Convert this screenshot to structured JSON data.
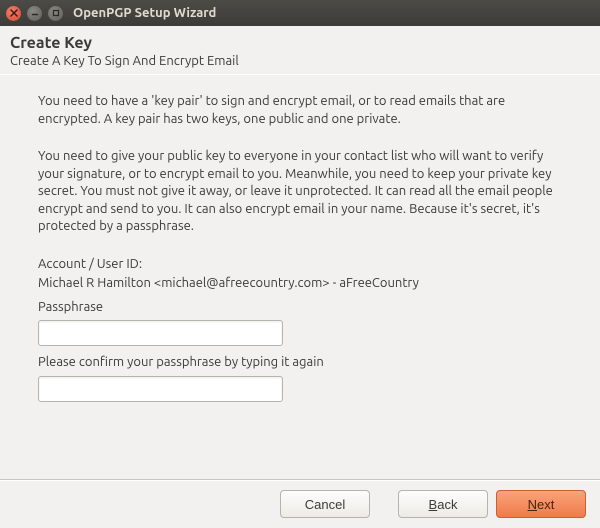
{
  "window": {
    "title": "OpenPGP Setup Wizard"
  },
  "header": {
    "title": "Create Key",
    "subtitle": "Create A Key To Sign And Encrypt Email"
  },
  "body": {
    "para1": "You need to have a 'key pair' to sign and encrypt email, or to read emails that are encrypted. A key pair has two keys, one public and one private.",
    "para2": "You need to give your public key to everyone in your contact list who will want to verify your signature, or to encrypt email to you. Meanwhile, you need to keep your private key secret. You must not give it away, or leave it unprotected. It can read all the email people encrypt and send to you. It can also encrypt email in your name. Because it's secret, it's protected by a passphrase.",
    "account_label": "Account / User ID:",
    "account_value": "Michael R Hamilton <michael@afreecountry.com> - aFreeCountry",
    "passphrase_label": "Passphrase",
    "confirm_label": "Please confirm your passphrase by typing it again"
  },
  "buttons": {
    "cancel": "Cancel",
    "back_prefix": "B",
    "back_rest": "ack",
    "next_prefix": "N",
    "next_rest": "ext"
  }
}
